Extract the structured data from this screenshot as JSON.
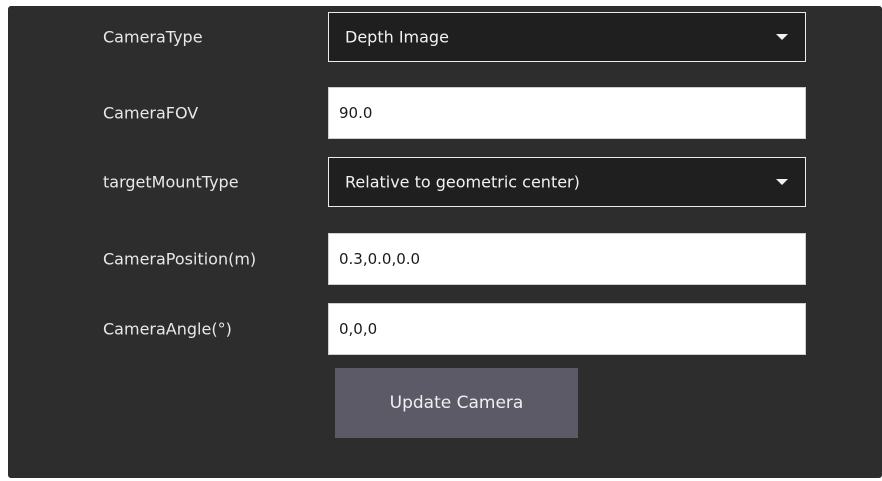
{
  "colors": {
    "panel_bg": "#2d2d2d",
    "dropdown_bg": "#1f1f1f",
    "input_bg": "#ffffff",
    "button_bg": "#5c5a67",
    "label_text": "#e8e8e8"
  },
  "form": {
    "camera_type": {
      "label": "CameraType",
      "value": "Depth Image",
      "icon": "chevron-down-icon"
    },
    "camera_fov": {
      "label": "CameraFOV",
      "value": "90.0"
    },
    "target_mount_type": {
      "label": "targetMountType",
      "value": "Relative to geometric center)",
      "icon": "chevron-down-icon"
    },
    "camera_position": {
      "label": "CameraPosition(m)",
      "value": "0.3,0.0,0.0"
    },
    "camera_angle": {
      "label": "CameraAngle(°)",
      "value": "0,0,0"
    }
  },
  "actions": {
    "update_camera_label": "Update Camera"
  }
}
